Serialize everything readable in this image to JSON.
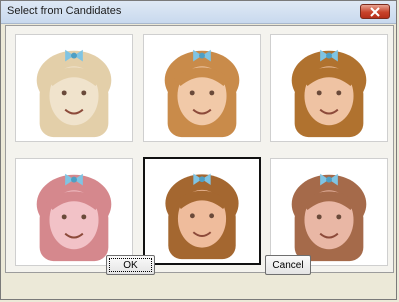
{
  "window": {
    "title": "Select from Candidates"
  },
  "candidates": [
    {
      "label": "candidate-1",
      "tone": "#f0e3cc",
      "hair": "#e3cfa9",
      "bg": "#ffffff"
    },
    {
      "label": "candidate-2",
      "tone": "#f1c9a8",
      "hair": "#c98b4a",
      "bg": "#ffffff"
    },
    {
      "label": "candidate-3",
      "tone": "#efc3a3",
      "hair": "#b0722f",
      "bg": "#ffffff"
    },
    {
      "label": "candidate-4",
      "tone": "#f2c2c7",
      "hair": "#d5888d",
      "bg": "#ffffff"
    },
    {
      "label": "candidate-5",
      "tone": "#efbc9c",
      "hair": "#a46730",
      "bg": "#ffffff"
    },
    {
      "label": "candidate-6",
      "tone": "#e9b7a5",
      "hair": "#a56a4a",
      "bg": "#ffffff"
    }
  ],
  "selected_index": 4,
  "buttons": {
    "ok_label": "OK",
    "cancel_label": "Cancel"
  },
  "colors": {
    "accent_selected": "#111111",
    "bow": "#7fc4e3"
  },
  "icons": {
    "close": "close-icon"
  }
}
